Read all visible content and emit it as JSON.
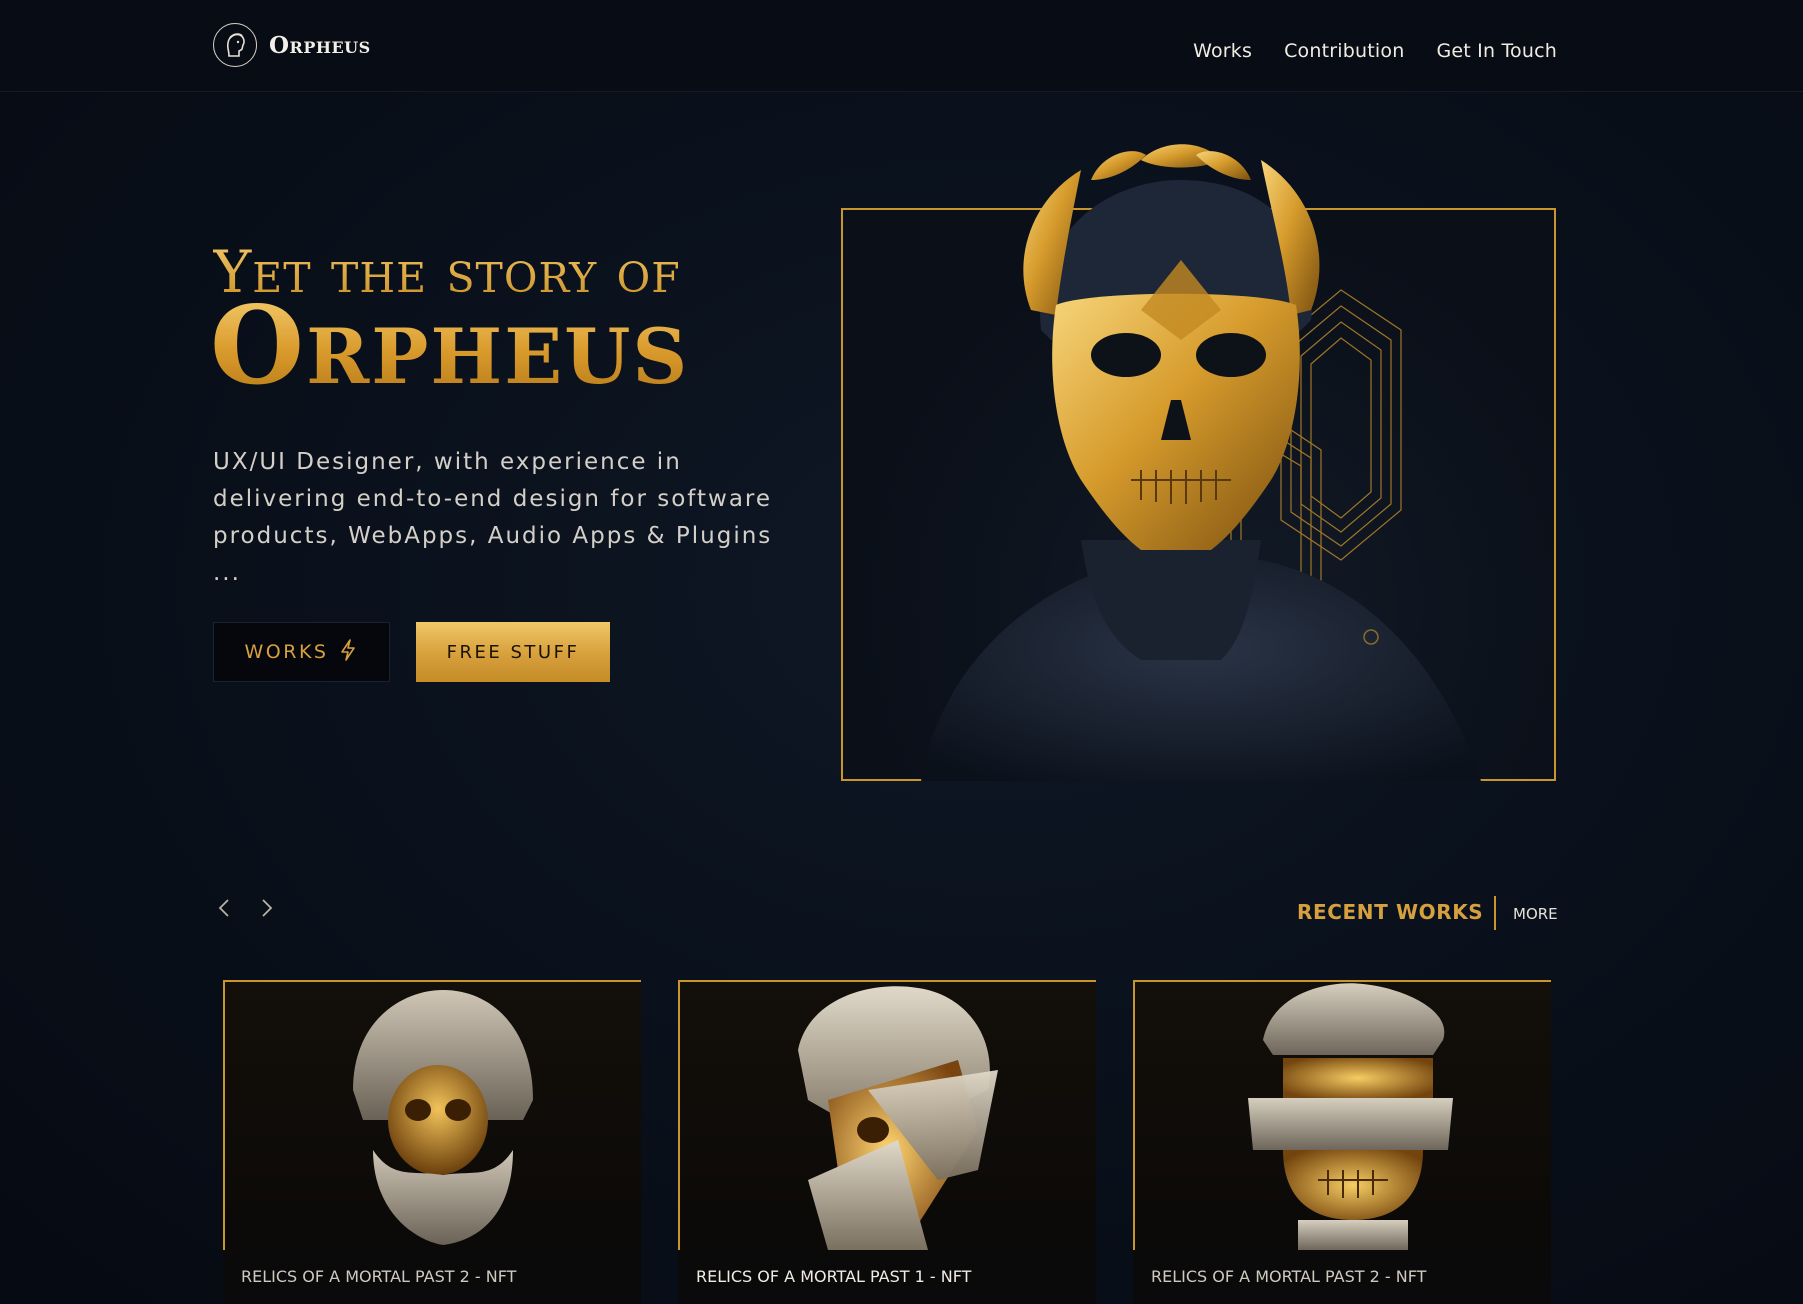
{
  "brand": {
    "name": "Orpheus",
    "logo_icon": "orpheus-bust-icon"
  },
  "nav": {
    "items": [
      {
        "label": "Works"
      },
      {
        "label": "Contribution"
      },
      {
        "label": "Get In Touch"
      }
    ]
  },
  "hero": {
    "title_small": "Yet the story of",
    "title_big": "Orpheus",
    "description": "UX/UI Designer, with experience in delivering end-to-end design for software products, WebApps, Audio Apps & Plugins ...",
    "buttons": {
      "works_label": "WORKS",
      "works_icon": "lightning-icon",
      "free_label": "FREE STUFF"
    },
    "image_icon": "gold-skull-bust-image"
  },
  "recent": {
    "title": "RECENT WORKS",
    "more_label": "MORE",
    "prev_icon": "chevron-left-icon",
    "next_icon": "chevron-right-icon",
    "cards": [
      {
        "caption": "RELICS OF A MORTAL PAST 2 - NFT"
      },
      {
        "caption": "RELICS OF A MORTAL PAST 1 - NFT"
      },
      {
        "caption": "RELICS OF A MORTAL PAST 2 - NFT"
      }
    ]
  },
  "colors": {
    "accent_gold": "#d6a03e",
    "background": "#0a111c",
    "text": "#f0ece4"
  }
}
